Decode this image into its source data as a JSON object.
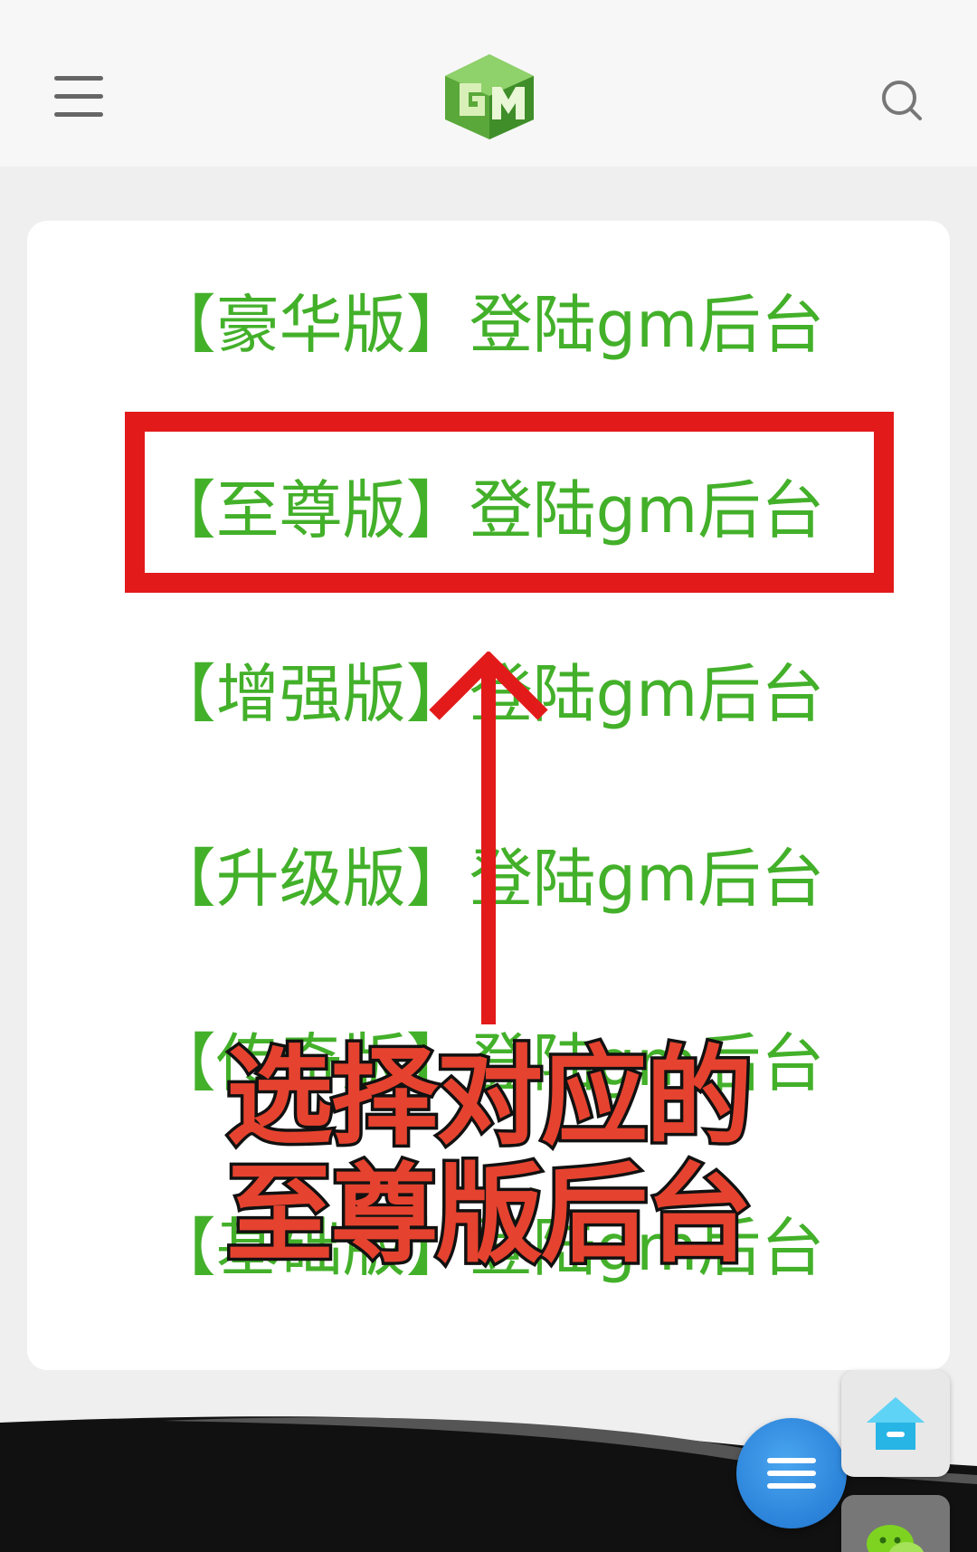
{
  "header": {
    "menu_icon": "hamburger-menu-icon",
    "logo_icon": "gm-cube-logo",
    "search_icon": "search-icon"
  },
  "card": {
    "links": [
      {
        "bracket_open": "【",
        "edition": "豪华版",
        "bracket_close": "】",
        "action": "登陆gm后台"
      },
      {
        "bracket_open": "【",
        "edition": "至尊版",
        "bracket_close": "】",
        "action": "登陆gm后台"
      },
      {
        "bracket_open": "【",
        "edition": "增强版",
        "bracket_close": "】",
        "action": "登陆gm后台"
      },
      {
        "bracket_open": "【",
        "edition": "升级版",
        "bracket_close": "】",
        "action": "登陆gm后台"
      },
      {
        "bracket_open": "【",
        "edition": "传奇版",
        "bracket_close": "】",
        "action": "登陆gm后台"
      },
      {
        "bracket_open": "【",
        "edition": "基础版",
        "bracket_close": "】",
        "action": "登陆gm后台"
      }
    ]
  },
  "overlay": {
    "line1": "选择对应的",
    "line2": "至尊版后台"
  },
  "colors": {
    "link_green": "#43b02a",
    "highlight_red": "#e31a1a",
    "overlay_fill": "#e5432f",
    "fab_blue": "#2a86dc"
  },
  "floating": {
    "menu_icon": "menu-icon",
    "home_icon": "home-icon",
    "wechat_icon": "wechat-icon"
  }
}
